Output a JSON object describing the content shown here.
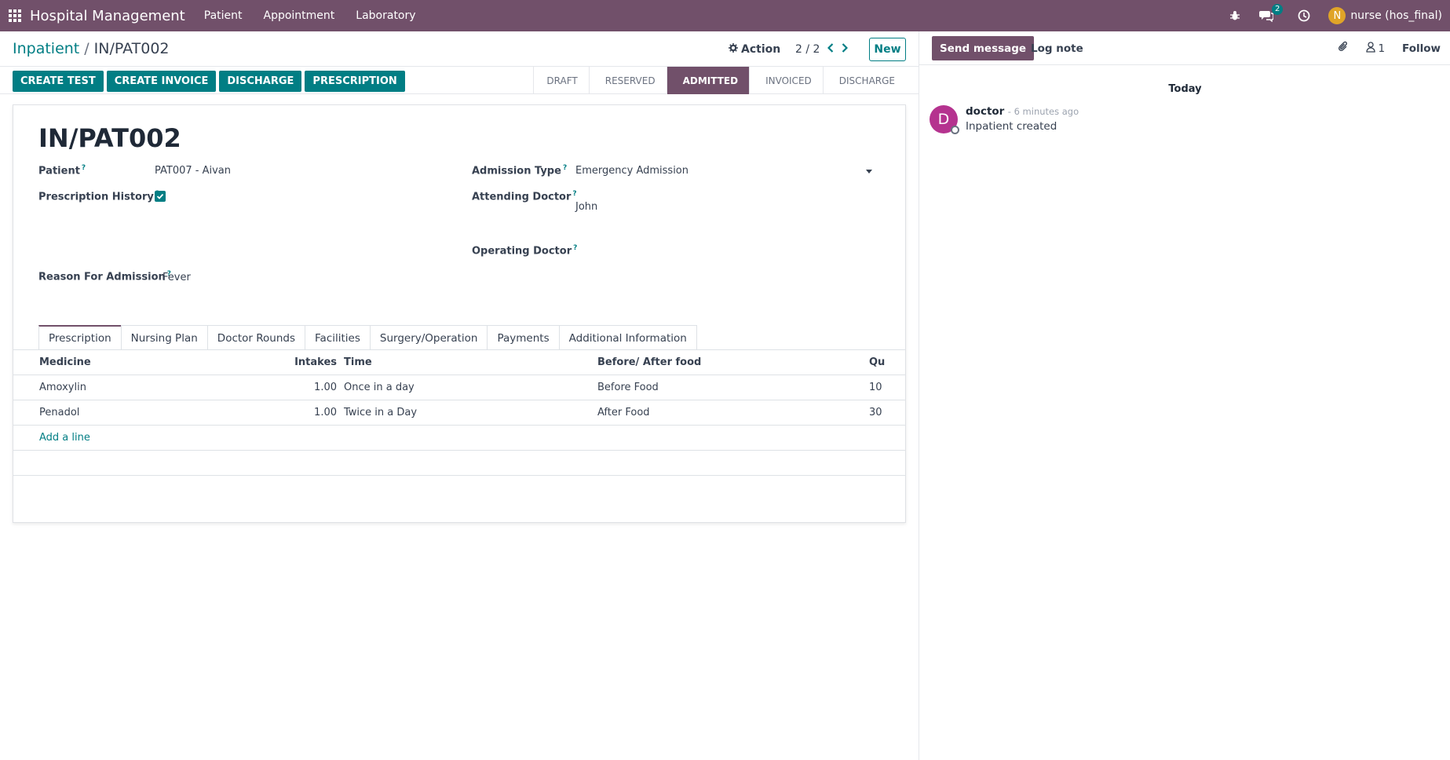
{
  "navbar": {
    "app_name": "Hospital Management",
    "menu": [
      "Patient",
      "Appointment",
      "Laboratory"
    ],
    "messages_count": "2",
    "user_initial": "N",
    "user_name": "nurse (hos_final)",
    "bg_color": "#71506a"
  },
  "control": {
    "breadcrumb_parent": "Inpatient",
    "breadcrumb_current": "IN/PAT002",
    "action_label": "Action",
    "pager": "2 / 2",
    "new_label": "New"
  },
  "header_buttons": [
    "CREATE TEST",
    "CREATE INVOICE",
    "DISCHARGE",
    "PRESCRIPTION"
  ],
  "stages": [
    "DRAFT",
    "RESERVED",
    "ADMITTED",
    "INVOICED",
    "DISCHARGE"
  ],
  "active_stage": "ADMITTED",
  "form": {
    "title": "IN/PAT002",
    "patient_label": "Patient",
    "patient_value": "PAT007 - Aivan",
    "prescription_history_label": "Prescription History",
    "prescription_history_checked": true,
    "reason_label": "Reason For Admission",
    "reason_value": "Fever",
    "admission_type_label": "Admission Type",
    "admission_type_value": "Emergency Admission",
    "attending_doctor_label": "Attending Doctor",
    "attending_doctor_value": "John",
    "operating_doctor_label": "Operating Doctor",
    "operating_doctor_value": ""
  },
  "tabs": [
    "Prescription",
    "Nursing Plan",
    "Doctor Rounds",
    "Facilities",
    "Surgery/Operation",
    "Payments",
    "Additional Information"
  ],
  "active_tab": "Prescription",
  "table": {
    "headers": {
      "medicine": "Medicine",
      "intakes": "Intakes",
      "time": "Time",
      "food": "Before/ After food",
      "qty": "Qu"
    },
    "rows": [
      {
        "medicine": "Amoxylin",
        "intakes": "1.00",
        "time": "Once in a day",
        "food": "Before Food",
        "qty": "10"
      },
      {
        "medicine": "Penadol",
        "intakes": "1.00",
        "time": "Twice in a Day",
        "food": "After Food",
        "qty": "30"
      }
    ],
    "add_line": "Add a line"
  },
  "chatter": {
    "send_message": "Send message",
    "log_note": "Log note",
    "followers_count": "1",
    "follow_label": "Follow",
    "date_separator": "Today",
    "messages": [
      {
        "avatar": "D",
        "author": "doctor",
        "time": "- 6 minutes ago",
        "body": "Inpatient created"
      }
    ]
  }
}
